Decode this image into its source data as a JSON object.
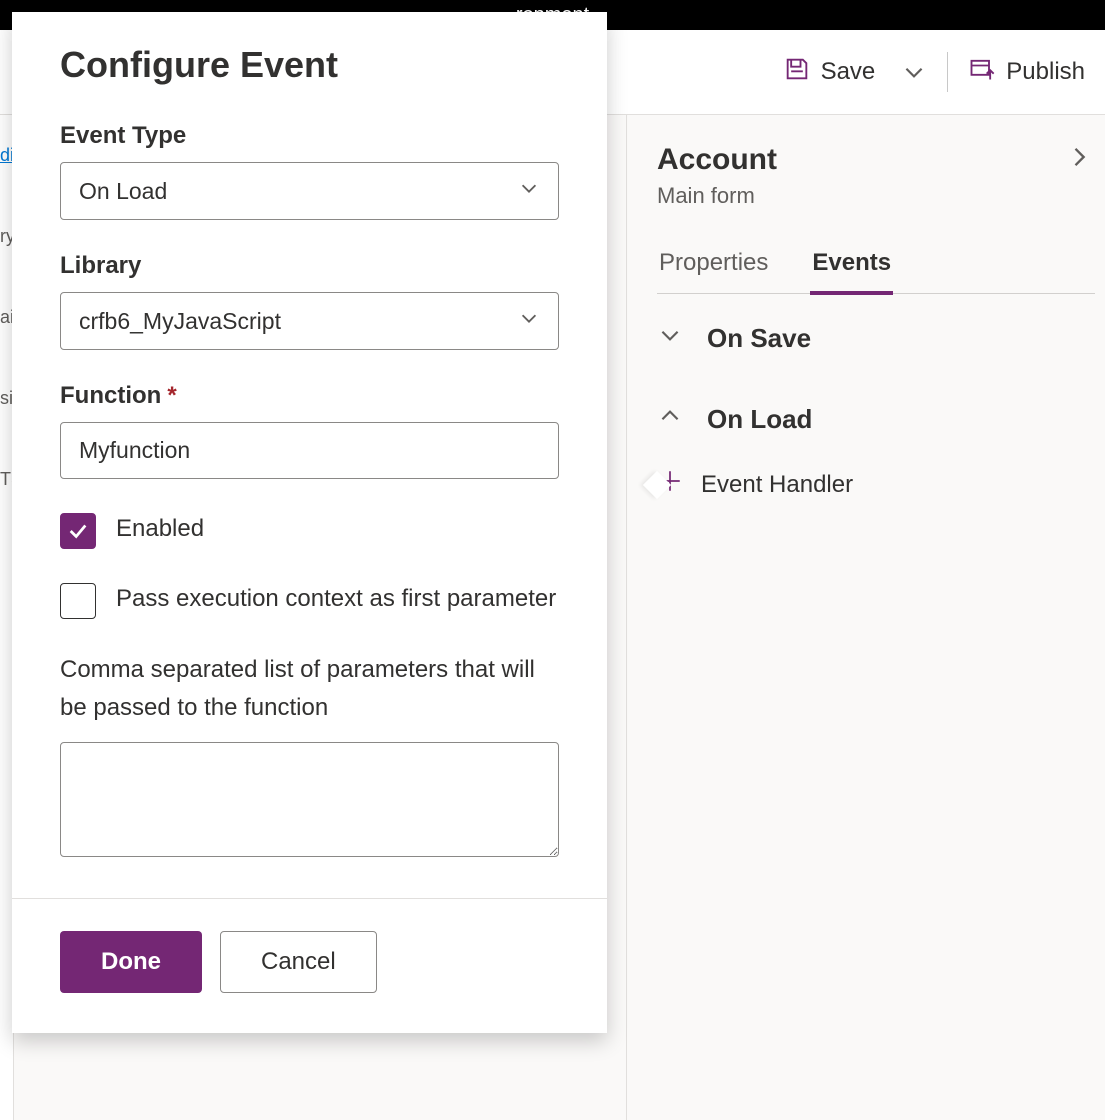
{
  "topbar": {
    "fragment": "ronment"
  },
  "toolbar": {
    "save_label": "Save",
    "publish_label": "Publish"
  },
  "left_strip": {
    "link_fragment": "di",
    "items": [
      "ry",
      "ai",
      "sin",
      "TS"
    ]
  },
  "right_panel": {
    "title": "Account",
    "subtitle": "Main form",
    "tabs": {
      "properties": "Properties",
      "events": "Events"
    },
    "sections": {
      "on_save": "On Save",
      "on_load": "On Load"
    },
    "add_handler": "Event Handler"
  },
  "dialog": {
    "title": "Configure Event",
    "event_type": {
      "label": "Event Type",
      "value": "On Load"
    },
    "library": {
      "label": "Library",
      "value": "crfb6_MyJavaScript"
    },
    "function": {
      "label": "Function",
      "value": "Myfunction"
    },
    "enabled": {
      "label": "Enabled",
      "checked": true
    },
    "pass_ctx": {
      "label": "Pass execution context as first parameter",
      "checked": false
    },
    "params": {
      "label": "Comma separated list of parameters that will be passed to the function",
      "value": ""
    },
    "done": "Done",
    "cancel": "Cancel"
  }
}
